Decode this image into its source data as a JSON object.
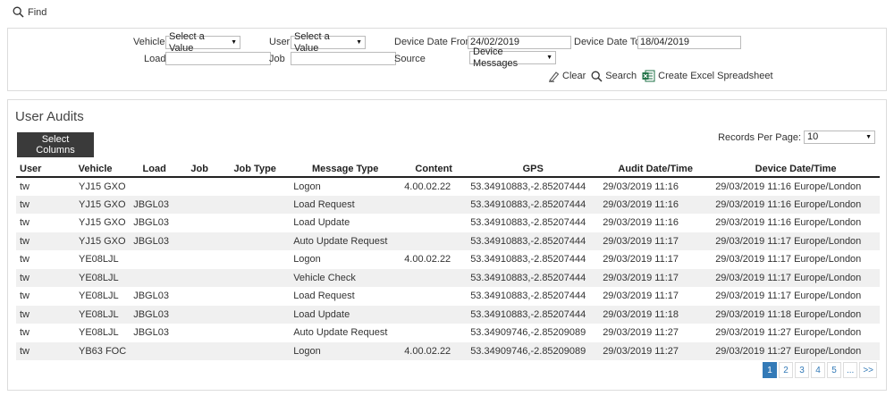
{
  "find": {
    "label": "Find"
  },
  "filters": {
    "vehicle_label": "Vehicle",
    "vehicle_value": "Select a Value",
    "user_label": "User",
    "user_value": "Select a Value",
    "date_from_label": "Device Date From",
    "date_from_value": "24/02/2019",
    "date_to_label": "Device Date To",
    "date_to_value": "18/04/2019",
    "load_label": "Load",
    "load_value": "",
    "job_label": "Job",
    "job_value": "",
    "source_label": "Source",
    "source_value": "Device Messages",
    "clear_label": "Clear",
    "search_label": "Search",
    "excel_label": "Create Excel Spreadsheet"
  },
  "audits": {
    "title": "User Audits",
    "select_columns_label": "Select Columns",
    "records_per_page_label": "Records Per Page:",
    "records_per_page_value": "10",
    "columns": [
      "User",
      "Vehicle",
      "Load",
      "Job",
      "Job Type",
      "Message Type",
      "Content",
      "GPS",
      "Audit Date/Time",
      "Device Date/Time"
    ],
    "rows": [
      [
        "tw",
        "YJ15 GXO",
        "",
        "",
        "",
        "Logon",
        "4.00.02.22",
        "53.34910883,-2.85207444",
        "29/03/2019 11:16",
        "29/03/2019 11:16 Europe/London"
      ],
      [
        "tw",
        "YJ15 GXO",
        "JBGL03",
        "",
        "",
        "Load Request",
        "",
        "53.34910883,-2.85207444",
        "29/03/2019 11:16",
        "29/03/2019 11:16 Europe/London"
      ],
      [
        "tw",
        "YJ15 GXO",
        "JBGL03",
        "",
        "",
        "Load Update",
        "",
        "53.34910883,-2.85207444",
        "29/03/2019 11:16",
        "29/03/2019 11:16 Europe/London"
      ],
      [
        "tw",
        "YJ15 GXO",
        "JBGL03",
        "",
        "",
        "Auto Update Request",
        "",
        "53.34910883,-2.85207444",
        "29/03/2019 11:17",
        "29/03/2019 11:17 Europe/London"
      ],
      [
        "tw",
        "YE08LJL",
        "",
        "",
        "",
        "Logon",
        "4.00.02.22",
        "53.34910883,-2.85207444",
        "29/03/2019 11:17",
        "29/03/2019 11:17 Europe/London"
      ],
      [
        "tw",
        "YE08LJL",
        "",
        "",
        "",
        "Vehicle Check",
        "",
        "53.34910883,-2.85207444",
        "29/03/2019 11:17",
        "29/03/2019 11:17 Europe/London"
      ],
      [
        "tw",
        "YE08LJL",
        "JBGL03",
        "",
        "",
        "Load Request",
        "",
        "53.34910883,-2.85207444",
        "29/03/2019 11:17",
        "29/03/2019 11:17 Europe/London"
      ],
      [
        "tw",
        "YE08LJL",
        "JBGL03",
        "",
        "",
        "Load Update",
        "",
        "53.34910883,-2.85207444",
        "29/03/2019 11:18",
        "29/03/2019 11:18 Europe/London"
      ],
      [
        "tw",
        "YE08LJL",
        "JBGL03",
        "",
        "",
        "Auto Update Request",
        "",
        "53.34909746,-2.85209089",
        "29/03/2019 11:27",
        "29/03/2019 11:27 Europe/London"
      ],
      [
        "tw",
        "YB63 FOC",
        "",
        "",
        "",
        "Logon",
        "4.00.02.22",
        "53.34909746,-2.85209089",
        "29/03/2019 11:27",
        "29/03/2019 11:27 Europe/London"
      ]
    ],
    "pagination": [
      "1",
      "2",
      "3",
      "4",
      "5",
      "...",
      ">>"
    ],
    "active_page": "1"
  },
  "colors": {
    "accent": "#337ab7",
    "button_dark": "#3a3a3a",
    "excel_green": "#1e7145"
  }
}
